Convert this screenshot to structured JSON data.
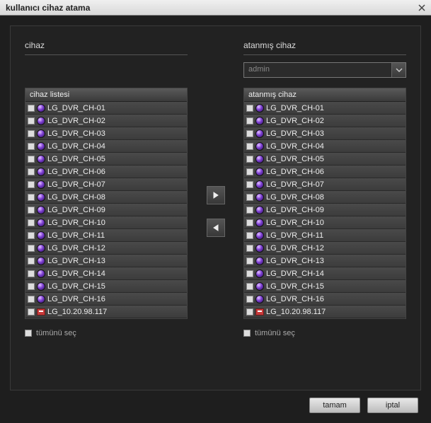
{
  "window": {
    "title": "kullanıcı cihaz atama"
  },
  "left": {
    "section_label": "cihaz",
    "list_header": "cihaz listesi",
    "select_all": "tümünü seç",
    "items": [
      {
        "label": "LG_DVR_CH-01",
        "type": "cam"
      },
      {
        "label": "LG_DVR_CH-02",
        "type": "cam"
      },
      {
        "label": "LG_DVR_CH-03",
        "type": "cam"
      },
      {
        "label": "LG_DVR_CH-04",
        "type": "cam"
      },
      {
        "label": "LG_DVR_CH-05",
        "type": "cam"
      },
      {
        "label": "LG_DVR_CH-06",
        "type": "cam"
      },
      {
        "label": "LG_DVR_CH-07",
        "type": "cam"
      },
      {
        "label": "LG_DVR_CH-08",
        "type": "cam"
      },
      {
        "label": "LG_DVR_CH-09",
        "type": "cam"
      },
      {
        "label": "LG_DVR_CH-10",
        "type": "cam"
      },
      {
        "label": "LG_DVR_CH-11",
        "type": "cam"
      },
      {
        "label": "LG_DVR_CH-12",
        "type": "cam"
      },
      {
        "label": "LG_DVR_CH-13",
        "type": "cam"
      },
      {
        "label": "LG_DVR_CH-14",
        "type": "cam"
      },
      {
        "label": "LG_DVR_CH-15",
        "type": "cam"
      },
      {
        "label": "LG_DVR_CH-16",
        "type": "cam"
      },
      {
        "label": "LG_10.20.98.117",
        "type": "dvr"
      }
    ]
  },
  "right": {
    "section_label": "atanmış cihaz",
    "dropdown_value": "admin",
    "list_header": "atanmış cihaz",
    "select_all": "tümünü seç",
    "items": [
      {
        "label": "LG_DVR_CH-01",
        "type": "cam"
      },
      {
        "label": "LG_DVR_CH-02",
        "type": "cam"
      },
      {
        "label": "LG_DVR_CH-03",
        "type": "cam"
      },
      {
        "label": "LG_DVR_CH-04",
        "type": "cam"
      },
      {
        "label": "LG_DVR_CH-05",
        "type": "cam"
      },
      {
        "label": "LG_DVR_CH-06",
        "type": "cam"
      },
      {
        "label": "LG_DVR_CH-07",
        "type": "cam"
      },
      {
        "label": "LG_DVR_CH-08",
        "type": "cam"
      },
      {
        "label": "LG_DVR_CH-09",
        "type": "cam"
      },
      {
        "label": "LG_DVR_CH-10",
        "type": "cam"
      },
      {
        "label": "LG_DVR_CH-11",
        "type": "cam"
      },
      {
        "label": "LG_DVR_CH-12",
        "type": "cam"
      },
      {
        "label": "LG_DVR_CH-13",
        "type": "cam"
      },
      {
        "label": "LG_DVR_CH-14",
        "type": "cam"
      },
      {
        "label": "LG_DVR_CH-15",
        "type": "cam"
      },
      {
        "label": "LG_DVR_CH-16",
        "type": "cam"
      },
      {
        "label": "LG_10.20.98.117",
        "type": "dvr"
      }
    ]
  },
  "buttons": {
    "ok": "tamam",
    "cancel": "iptal"
  }
}
